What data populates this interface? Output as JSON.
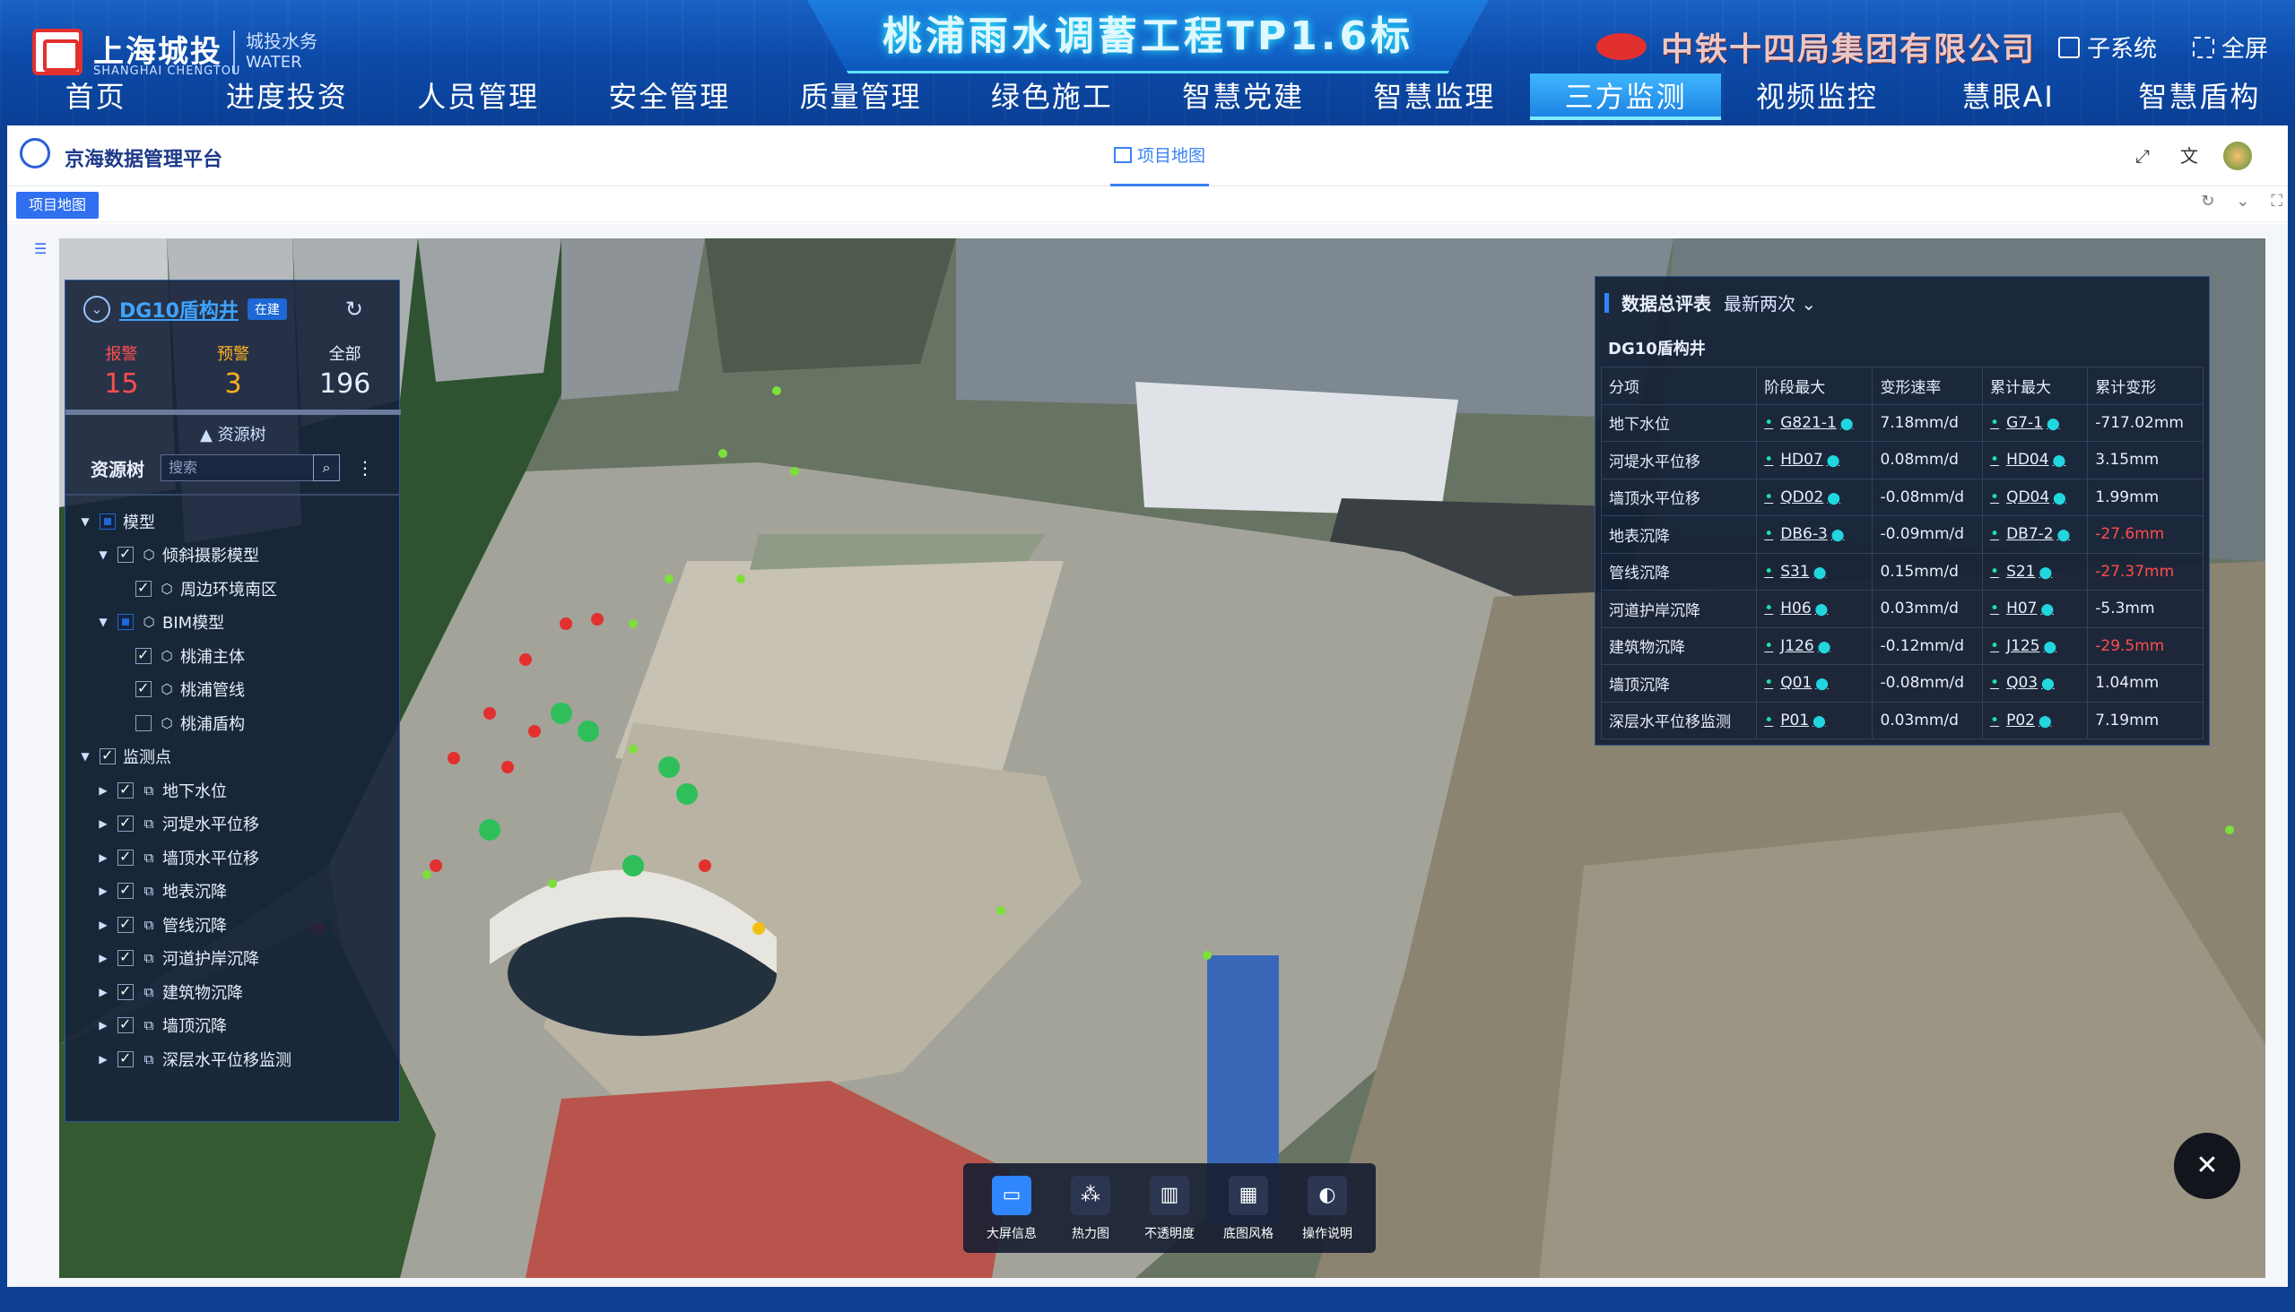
{
  "header": {
    "org_name": "上海城投",
    "org_name_en": "SHANGHAI CHENGTOU",
    "division": "城投水务",
    "division_en": "WATER",
    "project_title": "桃浦雨水调蓄工程TP1.6标",
    "contractor": "中铁十四局集团有限公司",
    "subsystem_label": "子系统",
    "fullscreen_label": "全屏"
  },
  "nav": {
    "items": [
      "首页",
      "进度投资",
      "人员管理",
      "安全管理",
      "质量管理",
      "绿色施工",
      "智慧党建",
      "智慧监理",
      "三方监测",
      "视频监控",
      "慧眼AI",
      "智慧盾构"
    ],
    "active": "三方监测"
  },
  "app": {
    "name": "京海数据管理平台",
    "center_tab": "项目地图",
    "page_tab": "项目地图"
  },
  "left_panel": {
    "site_name": "DG10盾构井",
    "status_badge": "在建",
    "stats": [
      {
        "label": "报警",
        "value": "15",
        "color": "#ff4d4f"
      },
      {
        "label": "预警",
        "value": "3",
        "color": "#ffb020"
      },
      {
        "label": "全部",
        "value": "196",
        "color": "#e8eefc"
      }
    ],
    "resource_toggle": "资源树",
    "resource_label": "资源树",
    "search_placeholder": "搜索",
    "tree": [
      {
        "label": "模型",
        "level": 0,
        "arrow": "▼",
        "check": "half",
        "icon": ""
      },
      {
        "label": "倾斜摄影模型",
        "level": 1,
        "arrow": "▼",
        "check": "on",
        "icon": "cube"
      },
      {
        "label": "周边环境南区",
        "level": 2,
        "arrow": "",
        "check": "on",
        "icon": "cube"
      },
      {
        "label": "BIM模型",
        "level": 1,
        "arrow": "▼",
        "check": "half",
        "icon": "cube"
      },
      {
        "label": "桃浦主体",
        "level": 2,
        "arrow": "",
        "check": "on",
        "icon": "cube"
      },
      {
        "label": "桃浦管线",
        "level": 2,
        "arrow": "",
        "check": "on",
        "icon": "cube"
      },
      {
        "label": "桃浦盾构",
        "level": 2,
        "arrow": "",
        "check": "off",
        "icon": "cube"
      },
      {
        "label": "监测点",
        "level": 0,
        "arrow": "▼",
        "check": "on",
        "icon": ""
      },
      {
        "label": "地下水位",
        "level": 1,
        "arrow": "▶",
        "check": "on",
        "icon": "layer"
      },
      {
        "label": "河堤水平位移",
        "level": 1,
        "arrow": "▶",
        "check": "on",
        "icon": "layer"
      },
      {
        "label": "墙顶水平位移",
        "level": 1,
        "arrow": "▶",
        "check": "on",
        "icon": "layer"
      },
      {
        "label": "地表沉降",
        "level": 1,
        "arrow": "▶",
        "check": "on",
        "icon": "layer"
      },
      {
        "label": "管线沉降",
        "level": 1,
        "arrow": "▶",
        "check": "on",
        "icon": "layer"
      },
      {
        "label": "河道护岸沉降",
        "level": 1,
        "arrow": "▶",
        "check": "on",
        "icon": "layer"
      },
      {
        "label": "建筑物沉降",
        "level": 1,
        "arrow": "▶",
        "check": "on",
        "icon": "layer"
      },
      {
        "label": "墙顶沉降",
        "level": 1,
        "arrow": "▶",
        "check": "on",
        "icon": "layer"
      },
      {
        "label": "深层水平位移监测",
        "level": 1,
        "arrow": "▶",
        "check": "on",
        "icon": "layer"
      }
    ]
  },
  "data_panel": {
    "title": "数据总评表",
    "mode": "最新两次",
    "site": "DG10盾构井",
    "columns": [
      "分项",
      "阶段最大",
      "变形速率",
      "累计最大",
      "累计变形"
    ],
    "rows": [
      {
        "item": "地下水位",
        "stage_max": "G821-1",
        "rate": "7.18mm/d",
        "cum_max": "G7-1",
        "cum": "-717.02mm",
        "alert": false
      },
      {
        "item": "河堤水平位移",
        "stage_max": "HD07",
        "rate": "0.08mm/d",
        "cum_max": "HD04",
        "cum": "3.15mm",
        "alert": false
      },
      {
        "item": "墙顶水平位移",
        "stage_max": "QD02",
        "rate": "-0.08mm/d",
        "cum_max": "QD04",
        "cum": "1.99mm",
        "alert": false
      },
      {
        "item": "地表沉降",
        "stage_max": "DB6-3",
        "rate": "-0.09mm/d",
        "cum_max": "DB7-2",
        "cum": "-27.6mm",
        "alert": true
      },
      {
        "item": "管线沉降",
        "stage_max": "S31",
        "rate": "0.15mm/d",
        "cum_max": "S21",
        "cum": "-27.37mm",
        "alert": true
      },
      {
        "item": "河道护岸沉降",
        "stage_max": "H06",
        "rate": "0.03mm/d",
        "cum_max": "H07",
        "cum": "-5.3mm",
        "alert": false
      },
      {
        "item": "建筑物沉降",
        "stage_max": "J126",
        "rate": "-0.12mm/d",
        "cum_max": "J125",
        "cum": "-29.5mm",
        "alert": true
      },
      {
        "item": "墙顶沉降",
        "stage_max": "Q01",
        "rate": "-0.08mm/d",
        "cum_max": "Q03",
        "cum": "1.04mm",
        "alert": false
      },
      {
        "item": "深层水平位移监测",
        "stage_max": "P01",
        "rate": "0.03mm/d",
        "cum_max": "P02",
        "cum": "7.19mm",
        "alert": false
      }
    ]
  },
  "bottom_toolbar": [
    {
      "label": "大屏信息",
      "icon": "monitor-icon",
      "active": true
    },
    {
      "label": "热力图",
      "icon": "heatmap-icon",
      "active": false
    },
    {
      "label": "不透明度",
      "icon": "opacity-icon",
      "active": false
    },
    {
      "label": "底图风格",
      "icon": "basemap-icon",
      "active": false
    },
    {
      "label": "操作说明",
      "icon": "mouse-icon",
      "active": false
    }
  ],
  "colors": {
    "alarm": "#ff4d4f",
    "warning": "#ffb020",
    "accent": "#2f86ff",
    "marker_ok": "#7ddf3a"
  }
}
